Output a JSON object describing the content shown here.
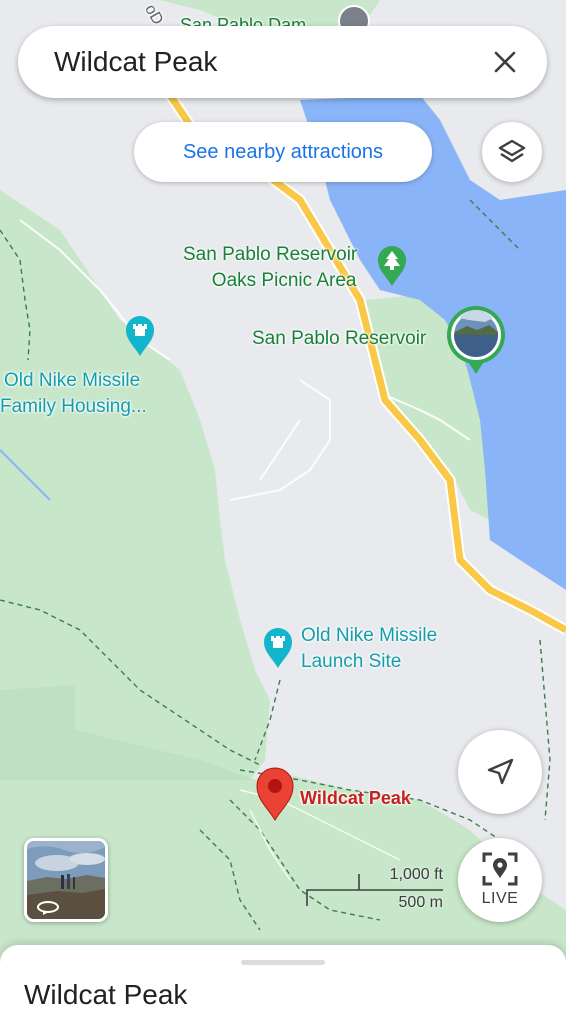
{
  "search": {
    "query": "Wildcat Peak"
  },
  "nearby_button": {
    "label": "See nearby attractions"
  },
  "map_labels": {
    "picnic_area": [
      "San Pablo Reservoir",
      "Oaks Picnic Area"
    ],
    "reservoir": "San Pablo Reservoir",
    "nike_housing": [
      "Old Nike Missile",
      "Family Housing..."
    ],
    "nike_launch": [
      "Old Nike Missile",
      "Launch Site"
    ],
    "wildcat_peak": "Wildcat Peak",
    "top_partial": "San Pablo Dam",
    "road_partial": "oD"
  },
  "scale": {
    "imperial": "1,000 ft",
    "metric": "500 m"
  },
  "live_button": {
    "label": "LIVE"
  },
  "bottom_sheet": {
    "title": "Wildcat Peak"
  },
  "icons": [
    "close-icon",
    "layers-icon",
    "navigation-arrow-icon",
    "live-view-icon",
    "park-pin-icon",
    "landmark-pin-icon",
    "photo-pin-icon",
    "red-place-pin-icon",
    "rotate-360-icon"
  ],
  "colors": {
    "water": "#8ab4f8",
    "park": "#c8e6c9",
    "land": "#e8eaed",
    "highway": "#f9c847",
    "accent": "#1a73e8",
    "selected_pin": "#ea4335"
  }
}
